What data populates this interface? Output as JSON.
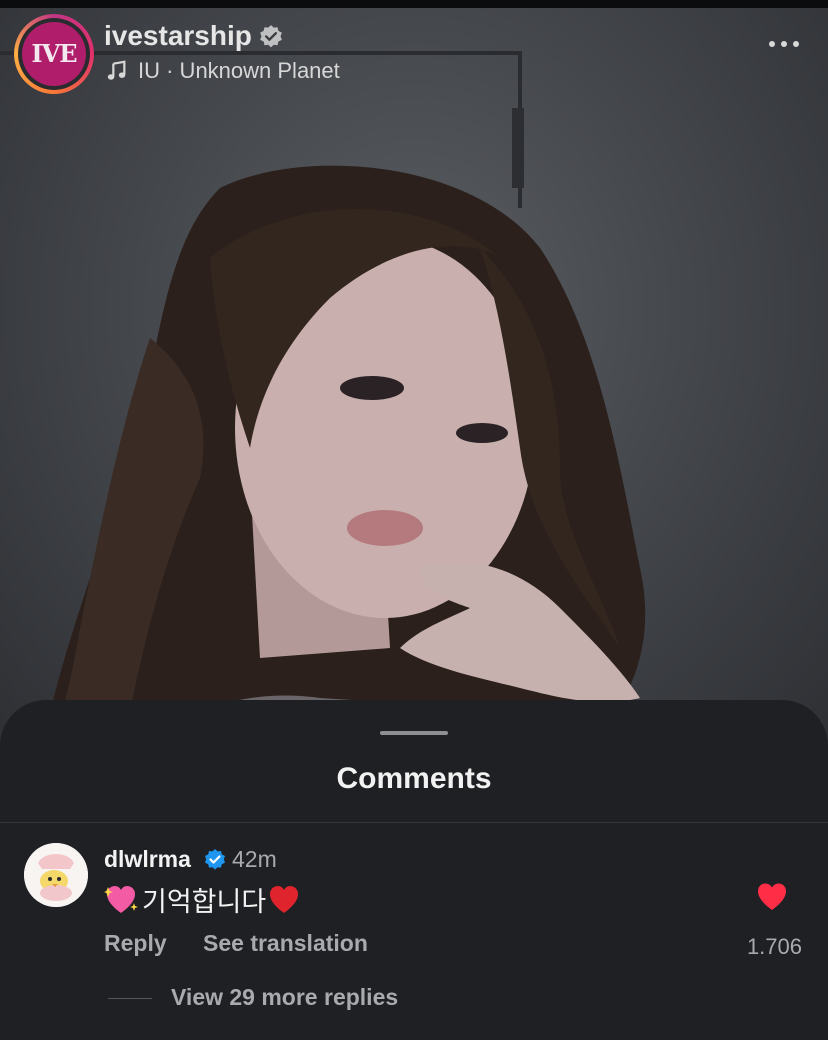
{
  "post": {
    "username": "ivestarship",
    "avatar_text": "IVE",
    "music": "IU · Unknown Planet",
    "icons": {
      "verified": "verified-badge-icon",
      "music": "music-note-icon",
      "more": "more-options-icon"
    }
  },
  "comments_sheet": {
    "title": "Comments",
    "comment": {
      "username": "dlwlrma",
      "time": "42m",
      "text": "기억합니다",
      "reply_label": "Reply",
      "translate_label": "See translation",
      "like_count": "1.706",
      "view_replies": "View 29 more replies",
      "icons": {
        "leading_emoji": "sparkling-heart-icon",
        "trailing_emoji": "red-heart-icon",
        "like": "heart-filled-icon"
      }
    }
  },
  "colors": {
    "accent_blue": "#1e96f0",
    "like_red": "#ff2d46",
    "sheet_bg": "#1f2023"
  }
}
